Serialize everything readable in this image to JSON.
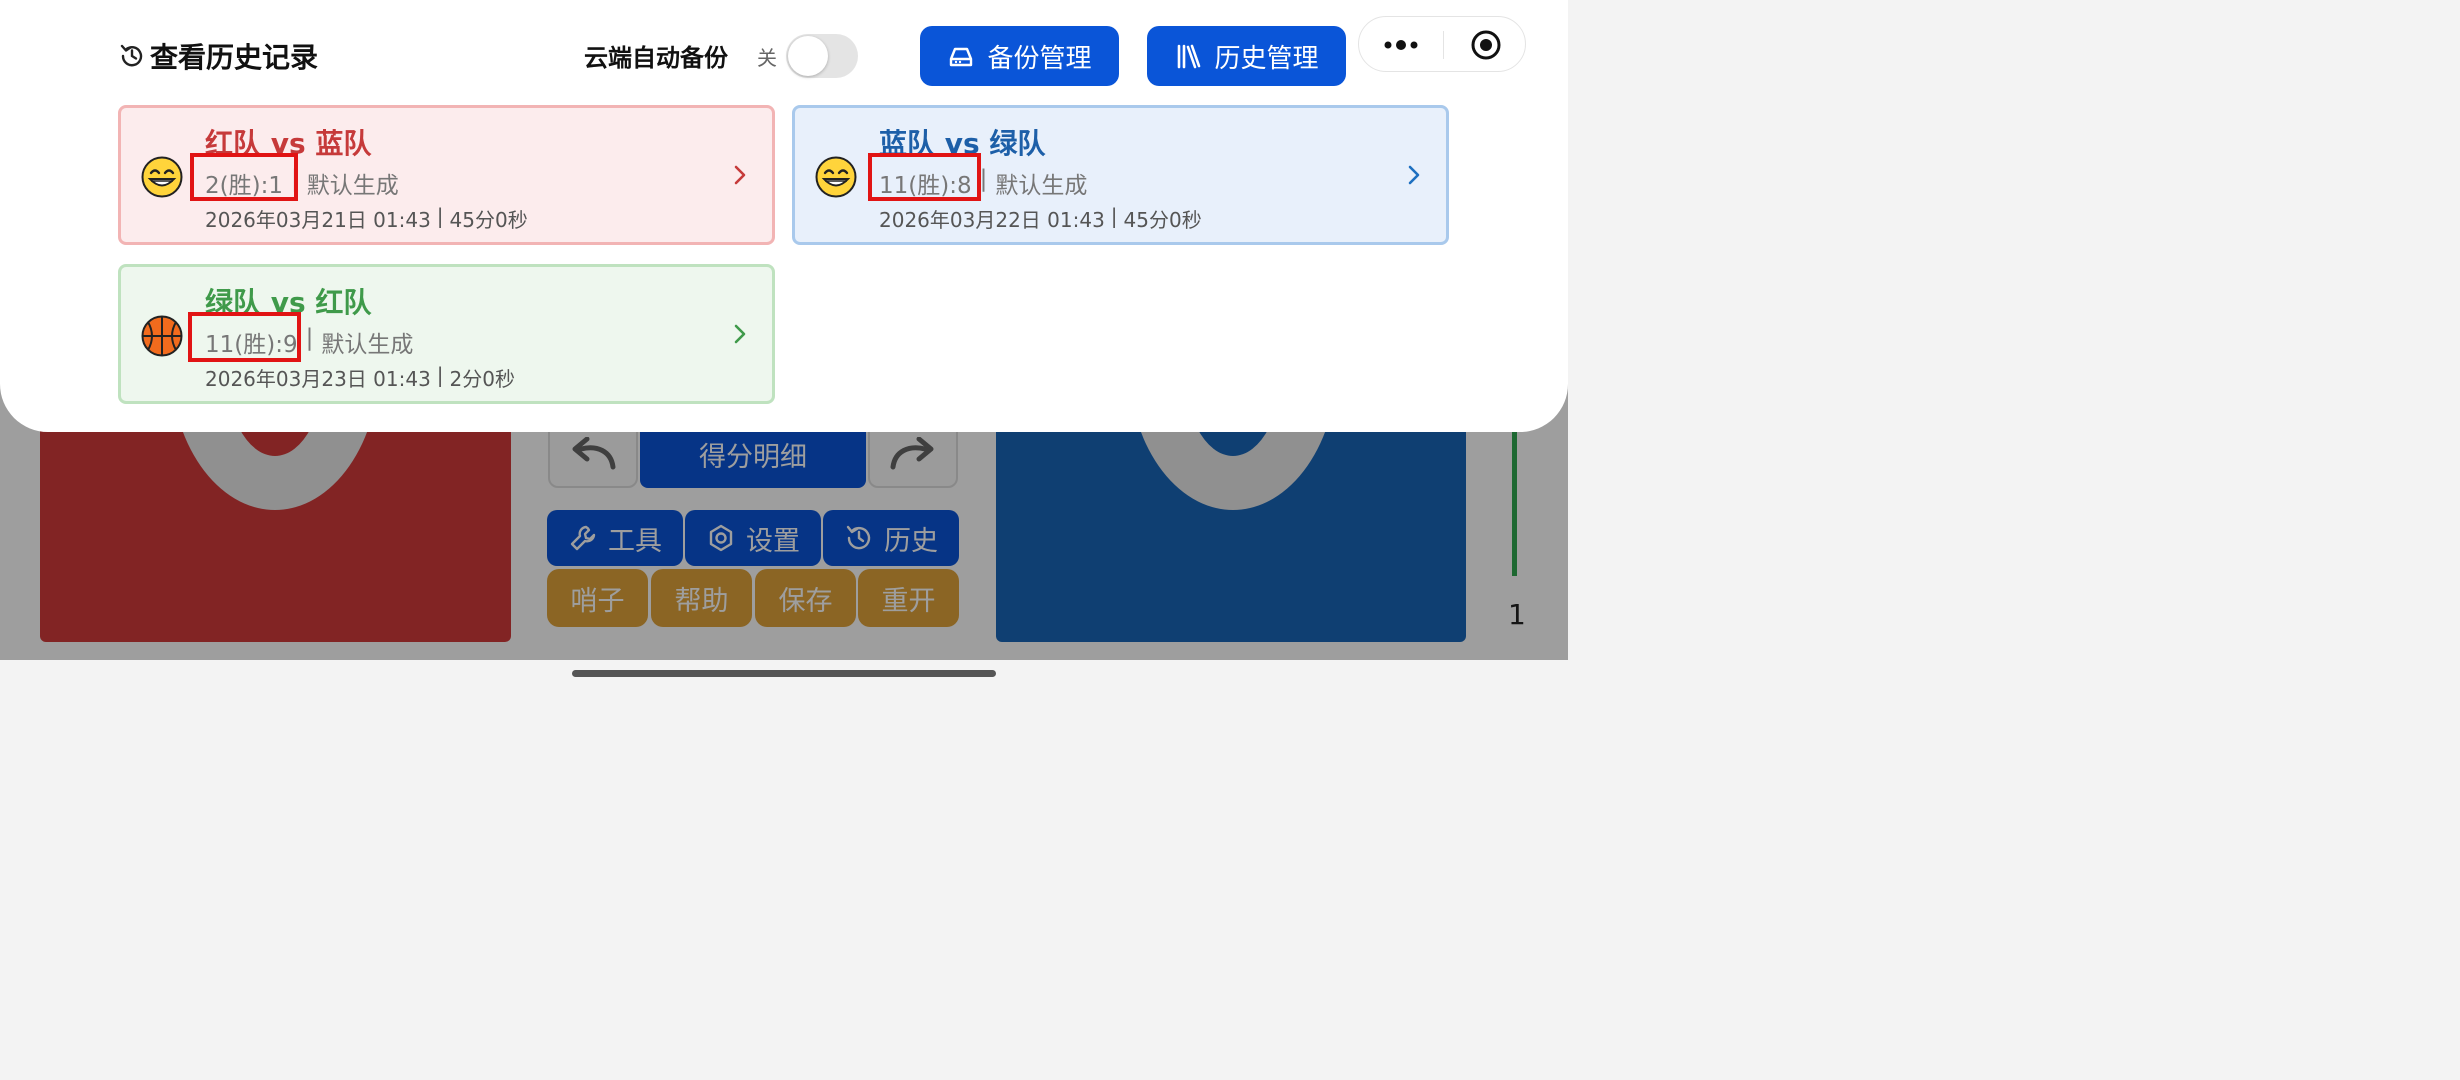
{
  "header": {
    "title": "查看历史记录",
    "cloud_backup_label": "云端自动备份",
    "toggle_state": "关",
    "backup_button": "备份管理",
    "history_button": "历史管理"
  },
  "cards": [
    {
      "title": "红队 vs 蓝队",
      "score": "2(胜):1",
      "note": "默认生成",
      "date": "2026年03月21日 01:43",
      "duration": "45分0秒",
      "icon": "grinning-face-icon"
    },
    {
      "title": "蓝队 vs 绿队",
      "score": "11(胜):8",
      "note": "默认生成",
      "date": "2026年03月22日 01:43",
      "duration": "45分0秒",
      "icon": "grinning-face-icon"
    },
    {
      "title": "绿队 vs 红队",
      "score": "11(胜):9",
      "note": "默认生成",
      "date": "2026年03月23日 01:43",
      "duration": "2分0秒",
      "icon": "basketball-icon"
    }
  ],
  "separator": "|",
  "background_app": {
    "score_red": "0",
    "score_blue": "0",
    "detail_button": "得分明细",
    "tools": [
      "工具",
      "设置",
      "历史"
    ],
    "actions": [
      "哨子",
      "帮助",
      "保存",
      "重开"
    ],
    "side_number": "1"
  },
  "colors": {
    "primary_blue": "#0a55d8",
    "red_team": "#d23a3a",
    "blue_team": "#1967b8",
    "highlight_red": "#e11414"
  }
}
